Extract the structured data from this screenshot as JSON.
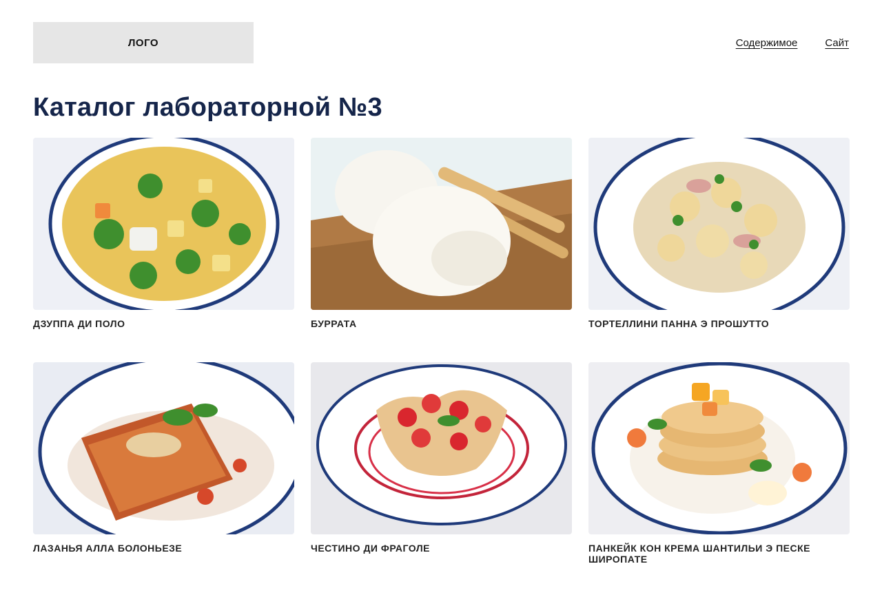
{
  "header": {
    "logo": "ЛОГО",
    "nav": [
      "Содержимое",
      "Сайт"
    ]
  },
  "page_title": "Каталог лабораторной №3",
  "catalog": [
    {
      "name": "ДЗУППА ДИ ПОЛО",
      "image": "soup-dish"
    },
    {
      "name": "БУРРАТА",
      "image": "burrata-dish"
    },
    {
      "name": "ТОРТЕЛЛИНИ ПАННА Э ПРОШУТТО",
      "image": "tortellini-dish"
    },
    {
      "name": "ЛАЗАНЬЯ АЛЛА БОЛОНЬЕЗЕ",
      "image": "lasagna-dish"
    },
    {
      "name": "ЧЕСТИНО ДИ ФРАГОЛЕ",
      "image": "strawberry-dessert-dish"
    },
    {
      "name": "ПАНКЕЙК КОН КРЕМА ШАНТИЛЬИ Э ПЕСКЕ ШИРОПАТЕ",
      "image": "pancake-dish"
    }
  ],
  "colors": {
    "title": "#15254a",
    "plate_rim": "#1f3a7a",
    "logo_bg": "#e6e6e6"
  }
}
